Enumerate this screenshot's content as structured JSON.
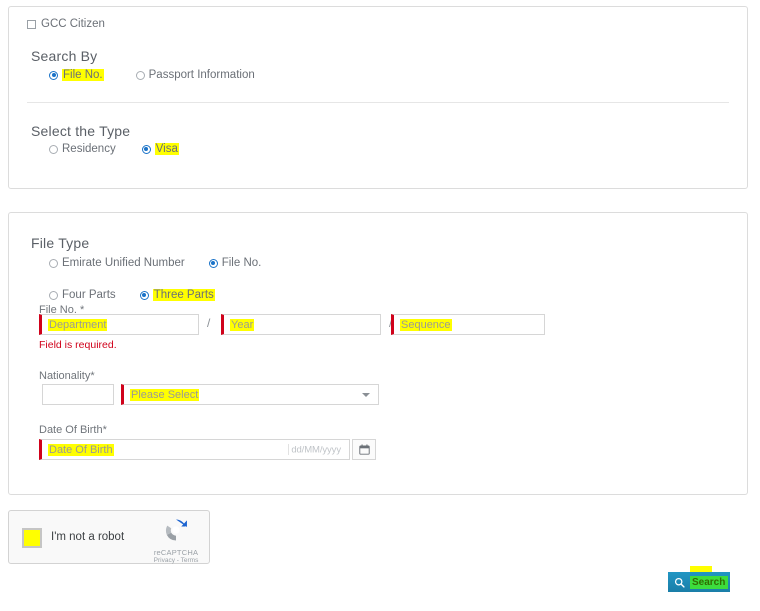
{
  "search_panel": {
    "gcc_checkbox": {
      "label": "GCC Citizen",
      "checked": false
    },
    "search_by": {
      "title": "Search By",
      "options": [
        {
          "label": "File No.",
          "selected": true,
          "highlighted": true
        },
        {
          "label": "Passport Information",
          "selected": false,
          "highlighted": false
        }
      ]
    },
    "select_type": {
      "title": "Select the Type",
      "options": [
        {
          "label": "Residency",
          "selected": false,
          "highlighted": false
        },
        {
          "label": "Visa",
          "selected": true,
          "highlighted": true
        }
      ]
    }
  },
  "file_type_panel": {
    "title": "File Type",
    "id_type_options": [
      {
        "label": "Emirate Unified Number",
        "selected": false,
        "highlighted": false
      },
      {
        "label": "File No.",
        "selected": true,
        "highlighted": true
      }
    ],
    "parts_options": [
      {
        "label": "Four Parts",
        "selected": false,
        "highlighted": false
      },
      {
        "label": "Three Parts",
        "selected": true,
        "highlighted": true
      }
    ],
    "file_no": {
      "label": "File No. *",
      "label_text": "File No.",
      "separator": "/",
      "fields": [
        {
          "placeholder": "Department",
          "value": ""
        },
        {
          "placeholder": "Year",
          "value": ""
        },
        {
          "placeholder": "Sequence",
          "value": ""
        }
      ],
      "error": "Field is required."
    },
    "nationality": {
      "label": "Nationality*",
      "code_value": "",
      "select_value": "Please Select"
    },
    "date_of_birth": {
      "label": "Date Of Birth*",
      "placeholder": "Date Of Birth",
      "format_hint": "dd/MM/yyyy",
      "calendar_icon": "calendar-icon"
    }
  },
  "recaptcha": {
    "label": "I'm not a robot",
    "brand": "reCAPTCHA",
    "legal": "Privacy - Terms",
    "checked": false
  },
  "actions": {
    "search_label": "Search",
    "search_icon": "magnifier-icon"
  },
  "colors": {
    "highlight": "#ffff00",
    "error": "#d0021b",
    "radio_selected": "#1a73c8",
    "button": "#1a7ea8"
  }
}
